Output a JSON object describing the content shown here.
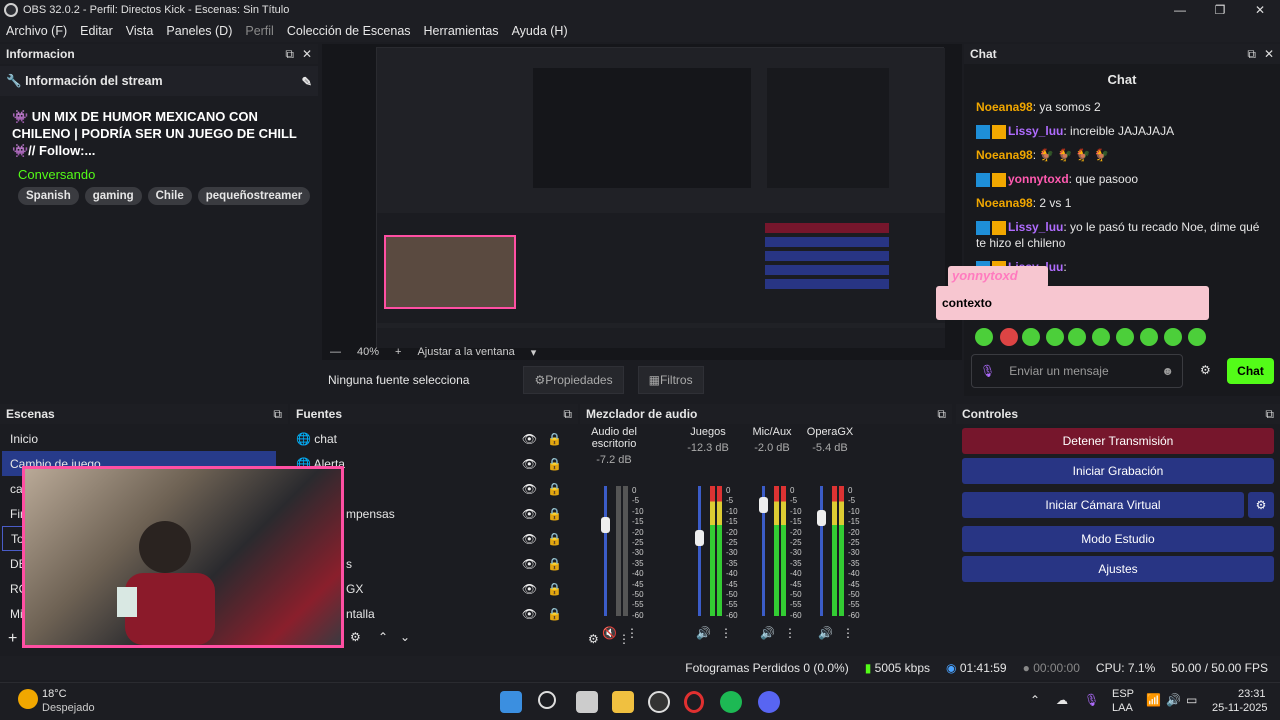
{
  "window": {
    "title": "OBS 32.0.2 - Perfil: Directos Kick - Escenas: Sin Título"
  },
  "menu": [
    "Archivo (F)",
    "Editar",
    "Vista",
    "Paneles (D)",
    "Perfil",
    "Colección de Escenas",
    "Herramientas",
    "Ayuda (H)"
  ],
  "info": {
    "dock_title": "Informacion",
    "sub_title": "Información del stream",
    "stream_title": "👾 UN MIX DE HUMOR MEXICANO CON CHILENO | PODRÍA SER UN JUEGO DE CHILL👾// Follow:...",
    "category": "Conversando",
    "tags": [
      "Spanish",
      "gaming",
      "Chile",
      "pequeñostreamer"
    ]
  },
  "preview": {
    "zoom": "40%",
    "fit": "Ajustar a la ventana",
    "no_source": "Ninguna fuente selecciona",
    "properties": "Propiedades",
    "filters": "Filtros"
  },
  "chat": {
    "dock_title": "Chat",
    "header": "Chat",
    "messages": [
      {
        "user": "Noeana98",
        "color": "#f1a700",
        "text": ": ya somos 2"
      },
      {
        "user": "Lissy_luu",
        "color": "#b06cff",
        "text": ": increible JAJAJAJA"
      },
      {
        "user": "Noeana98",
        "color": "#f1a700",
        "text": ": 🐓 🐓 🐓 🐓"
      },
      {
        "user": "yonnytoxd",
        "color": "#ff5ab0",
        "text": ": que pasooo"
      },
      {
        "user": "Noeana98",
        "color": "#f1a700",
        "text": ": 2 vs 1"
      },
      {
        "user": "Lissy_luu",
        "color": "#b06cff",
        "text": ": yo le pasó tu recado Noe, dime qué te hizo el chileno"
      },
      {
        "user": "Lissy_luu",
        "color": "#b06cff",
        "text": ":"
      }
    ],
    "overlay_user": "yonnytoxd",
    "overlay_text": "contexto",
    "input_placeholder": "Enviar un mensaje",
    "send": "Chat"
  },
  "scenes": {
    "title": "Escenas",
    "items": [
      "Inicio",
      "Cambio de juego",
      "ca",
      "Fin",
      "To",
      "DE",
      "RC",
      "Mi"
    ]
  },
  "sources": {
    "title": "Fuentes",
    "items": [
      "chat",
      "Alerta",
      "",
      "mpensas",
      "",
      "s",
      "GX",
      "ntalla"
    ]
  },
  "mixer": {
    "title": "Mezclador de audio",
    "channels": [
      {
        "name": "Audio del escritorio",
        "db": "-7.2 dB",
        "level": 0.72,
        "muted": true
      },
      {
        "name": "Juegos",
        "db": "-12.3 dB",
        "level": 0.6,
        "muted": false
      },
      {
        "name": "Mic/Aux",
        "db": "-2.0 dB",
        "level": 0.9,
        "muted": false
      },
      {
        "name": "OperaGX",
        "db": "-5.4 dB",
        "level": 0.78,
        "muted": false
      }
    ],
    "ticks": [
      "0",
      "-5",
      "-10",
      "-15",
      "-20",
      "-25",
      "-30",
      "-35",
      "-40",
      "-45",
      "-50",
      "-55",
      "-60"
    ]
  },
  "controls": {
    "title": "Controles",
    "buttons": [
      "Detener Transmisión",
      "Iniciar Grabación",
      "Iniciar Cámara Virtual",
      "Modo Estudio",
      "Ajustes"
    ]
  },
  "status": {
    "dropped": "Fotogramas Perdidos 0 (0.0%)",
    "kbps": "5005 kbps",
    "live_time": "01:41:59",
    "rec_time": "00:00:00",
    "cpu": "CPU: 7.1%",
    "fps": "50.00 / 50.00 FPS"
  },
  "taskbar": {
    "weather_temp": "18°C",
    "weather_desc": "Despejado",
    "lang": "ESP",
    "lang2": "LAA",
    "time": "23:31",
    "date": "25-11-2025"
  },
  "colors": {
    "kick_green": "#53fc18",
    "obs_blue": "#283584",
    "obs_red": "#76162c"
  }
}
